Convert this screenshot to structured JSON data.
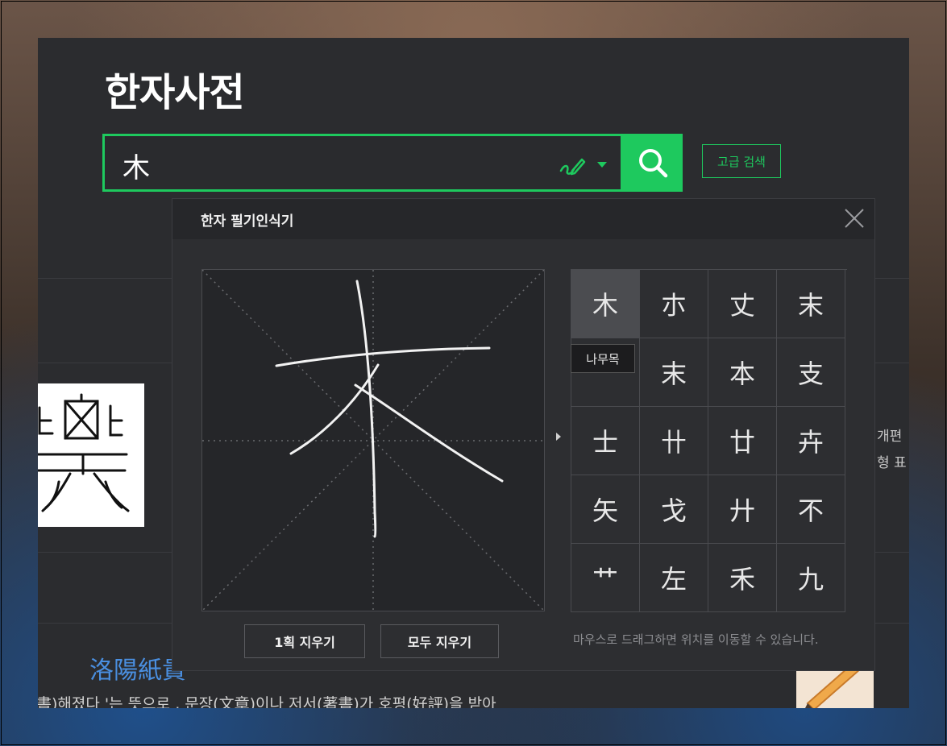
{
  "page": {
    "title": "한자사전",
    "search": {
      "value": "木"
    },
    "advanced_search_label": "고급 검색",
    "right_snippet_1": "개편",
    "right_snippet_2": "형 표",
    "idiom_title": "洛陽紙貴",
    "idiom_text": "書)해졌다 '는 뜻으로 , 문장(文章)이나 저서(著書)가 호평(好評)을 받아"
  },
  "handwriting": {
    "title": "한자 필기인식기",
    "candidates": [
      "木",
      "朩",
      "丈",
      "末",
      "",
      "末",
      "本",
      "支",
      "士",
      "卄",
      "廿",
      "卉",
      "矢",
      "戈",
      "廾",
      "不",
      "艹",
      "左",
      "禾",
      "九"
    ],
    "tooltip": "나무목",
    "undo_label": "1획 지우기",
    "clear_label": "모두 지우기",
    "hint": "마우스로 드래그하면 위치를 이동할 수 있습니다."
  },
  "colors": {
    "accent": "#1ec95e",
    "link": "#4a8fe0"
  }
}
